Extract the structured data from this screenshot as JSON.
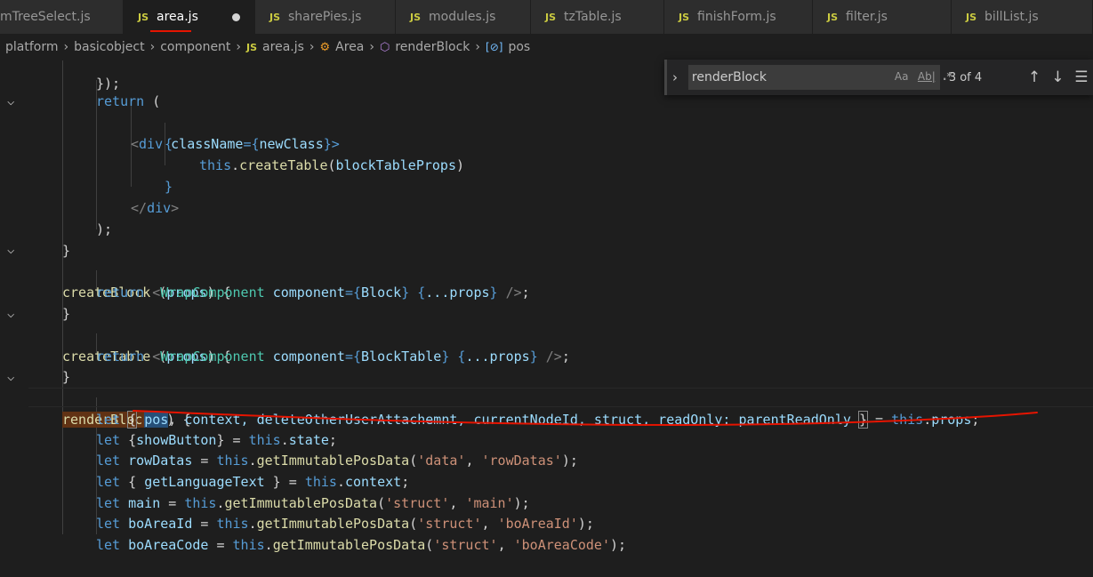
{
  "tabs": [
    {
      "label": "mTreeSelect.js",
      "active": false,
      "icon": "js-icon"
    },
    {
      "label": "area.js",
      "active": true,
      "icon": "js-icon",
      "dirty": true
    },
    {
      "label": "sharePies.js",
      "active": false,
      "icon": "js-icon"
    },
    {
      "label": "modules.js",
      "active": false,
      "icon": "js-icon"
    },
    {
      "label": "tzTable.js",
      "active": false,
      "icon": "js-icon"
    },
    {
      "label": "finishForm.js",
      "active": false,
      "icon": "js-icon"
    },
    {
      "label": "filter.js",
      "active": false,
      "icon": "js-icon"
    },
    {
      "label": "billList.js",
      "active": false,
      "icon": "js-icon"
    }
  ],
  "js_badge": "JS",
  "breadcrumb": {
    "items": [
      "platform",
      "basicobject",
      "component",
      "area.js",
      "Area",
      "renderBlock",
      "pos"
    ]
  },
  "find": {
    "value": "renderBlock",
    "match_case": "Aa",
    "whole_word": "Ab|",
    "regex": ".*",
    "count": "3 of 4"
  },
  "code": {
    "l0": "});",
    "l1_kw": "return",
    "l1_p": " (",
    "l2_open": "<",
    "l2_tag": "div",
    "l2_attr": "className",
    "l2_eq": "={",
    "l2_val": "newClass",
    "l2_close": "}>",
    "l3": "{",
    "l4_this": "this",
    "l4_fn": "createTable",
    "l4_arg": "blockTableProps",
    "l5": "}",
    "l6_tag": "div",
    "l7": ");",
    "l8": "}",
    "l9_fn": "createBlock",
    "l9_arg": "props",
    "l10_kw": "return",
    "l10_tag": "WrapComponent",
    "l10_attr": "component",
    "l10_val": "Block",
    "l10_spread": "...props",
    "l11": "}",
    "l12_fn": "createTable",
    "l12_arg": "props",
    "l13_kw": "return",
    "l13_tag": "WrapComponent",
    "l13_attr": "component",
    "l13_val": "BlockTable",
    "l13_spread": "...props",
    "l14": "}",
    "l15_fn": "renderBlock",
    "l16_kw": "let",
    "l16_pos": "pos",
    "l16_rest": "context, deleteOtherUserAttachemnt, currentNodeId, struct, readOnly: parentReadOnly",
    "l16_this": "this",
    "l16_prop": "props",
    "l17_kw": "let",
    "l17_var": "showButton",
    "l17_this": "this",
    "l17_prop": "state",
    "l18_kw": "let",
    "l18_var": "rowDatas",
    "l18_this": "this",
    "l18_fn": "getImmutablePosData",
    "l18_s1": "'data'",
    "l18_s2": "'rowDatas'",
    "l19_kw": "let",
    "l19_var": "getLanguageText",
    "l19_this": "this",
    "l19_prop": "context",
    "l20_kw": "let",
    "l20_var": "main",
    "l20_this": "this",
    "l20_fn": "getImmutablePosData",
    "l20_s1": "'struct'",
    "l20_s2": "'main'",
    "l21_kw": "let",
    "l21_var": "boAreaId",
    "l21_this": "this",
    "l21_fn": "getImmutablePosData",
    "l21_s1": "'struct'",
    "l21_s2": "'boAreaId'",
    "l22_kw": "let",
    "l22_var": "boAreaCode",
    "l22_this": "this",
    "l22_fn": "getImmutablePosData",
    "l22_s1": "'struct'",
    "l22_s2": "'boAreaCode'"
  },
  "colors": {
    "background": "#1e1e1e",
    "keyword": "#569cd6",
    "function": "#dcdcaa",
    "variable": "#9cdcfe",
    "string": "#ce9178",
    "component": "#4ec9b0",
    "find_highlight": "#613214",
    "annotation_stroke": "#e51400"
  }
}
